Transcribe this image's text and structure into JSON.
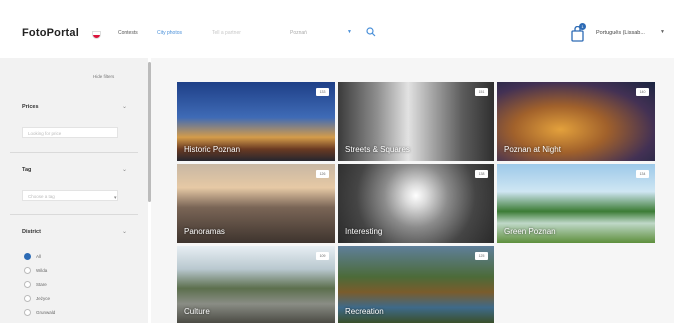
{
  "header": {
    "logo": "FotoPortal",
    "nav": [
      {
        "label": "Contests",
        "active": false,
        "faint": false
      },
      {
        "label": "City photos",
        "active": true,
        "faint": false
      },
      {
        "label": "Tell a partner",
        "active": false,
        "faint": true
      }
    ],
    "search": {
      "select_value": "Poznań"
    },
    "cart_count": "1",
    "language": "Português (Lissab..."
  },
  "sidebar": {
    "hide_filters": "Hide filters",
    "filters": [
      {
        "title": "Prices",
        "placeholder": "Looking for price"
      },
      {
        "title": "Tag",
        "placeholder": "Choose a tag"
      },
      {
        "title": "District"
      }
    ],
    "districts": [
      {
        "label": "All",
        "checked": true
      },
      {
        "label": "Wilda",
        "checked": false
      },
      {
        "label": "Stare",
        "checked": false
      },
      {
        "label": "Jeżyce",
        "checked": false
      },
      {
        "label": "Grunwald",
        "checked": false
      }
    ]
  },
  "gallery": [
    {
      "label": "Historic Poznan",
      "badge": "133"
    },
    {
      "label": "Streets & Squares",
      "badge": "151"
    },
    {
      "label": "Poznan at Night",
      "badge": "140"
    },
    {
      "label": "Panoramas",
      "badge": "126"
    },
    {
      "label": "Interesting",
      "badge": "138"
    },
    {
      "label": "Green Poznan",
      "badge": "134"
    },
    {
      "label": "Culture",
      "badge": "109"
    },
    {
      "label": "Recreation",
      "badge": "125"
    }
  ],
  "colors": {
    "accent": "#4a90d9",
    "brand_blue": "#2d6bb5",
    "sidebar_bg": "#f2f2f2"
  }
}
